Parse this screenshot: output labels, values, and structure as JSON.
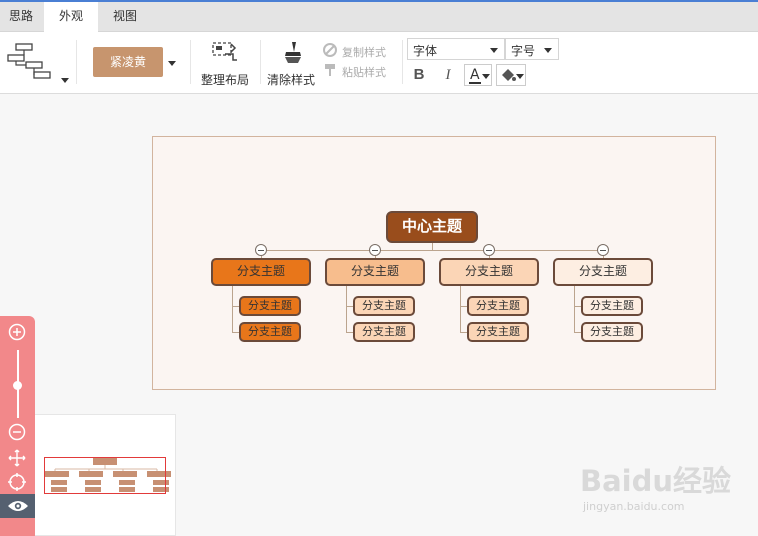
{
  "tabs": [
    {
      "label": "思路",
      "active": false
    },
    {
      "label": "外观",
      "active": true
    },
    {
      "label": "视图",
      "active": false
    }
  ],
  "ribbon": {
    "theme_label": "紧凌黄",
    "organize_label": "整理布局",
    "clear_style_label": "清除样式",
    "copy_style_label": "复制样式",
    "paste_style_label": "粘贴样式",
    "font_value": "字体",
    "size_value": "字号",
    "bold_label": "B",
    "italic_label": "I",
    "font_color_label": "A"
  },
  "mindmap": {
    "center": "中心主题",
    "branches": [
      {
        "label": "分支主题",
        "color": "#e8761a",
        "subs": [
          "分支主题",
          "分支主题"
        ]
      },
      {
        "label": "分支主题",
        "color": "#f7bd8d",
        "subs": [
          "分支主题",
          "分支主题"
        ]
      },
      {
        "label": "分支主题",
        "color": "#fbd5b6",
        "subs": [
          "分支主题",
          "分支主题"
        ]
      },
      {
        "label": "分支主题",
        "color": "#fdeee2",
        "subs": [
          "分支主题",
          "分支主题"
        ]
      }
    ],
    "sub_colors": [
      "#e8761a",
      "#fbd5b6",
      "#fbd5b6",
      "#fdeee2"
    ]
  },
  "colors": {
    "accent_blue": "#4a7fd4",
    "theme_button": "#c7956e",
    "zoom_panel": "#f2888a",
    "center_node": "#994d1c",
    "node_border": "#6b4a3a"
  },
  "watermark": {
    "brand": "Baidu经验",
    "site": "jingyan.baidu.com"
  }
}
